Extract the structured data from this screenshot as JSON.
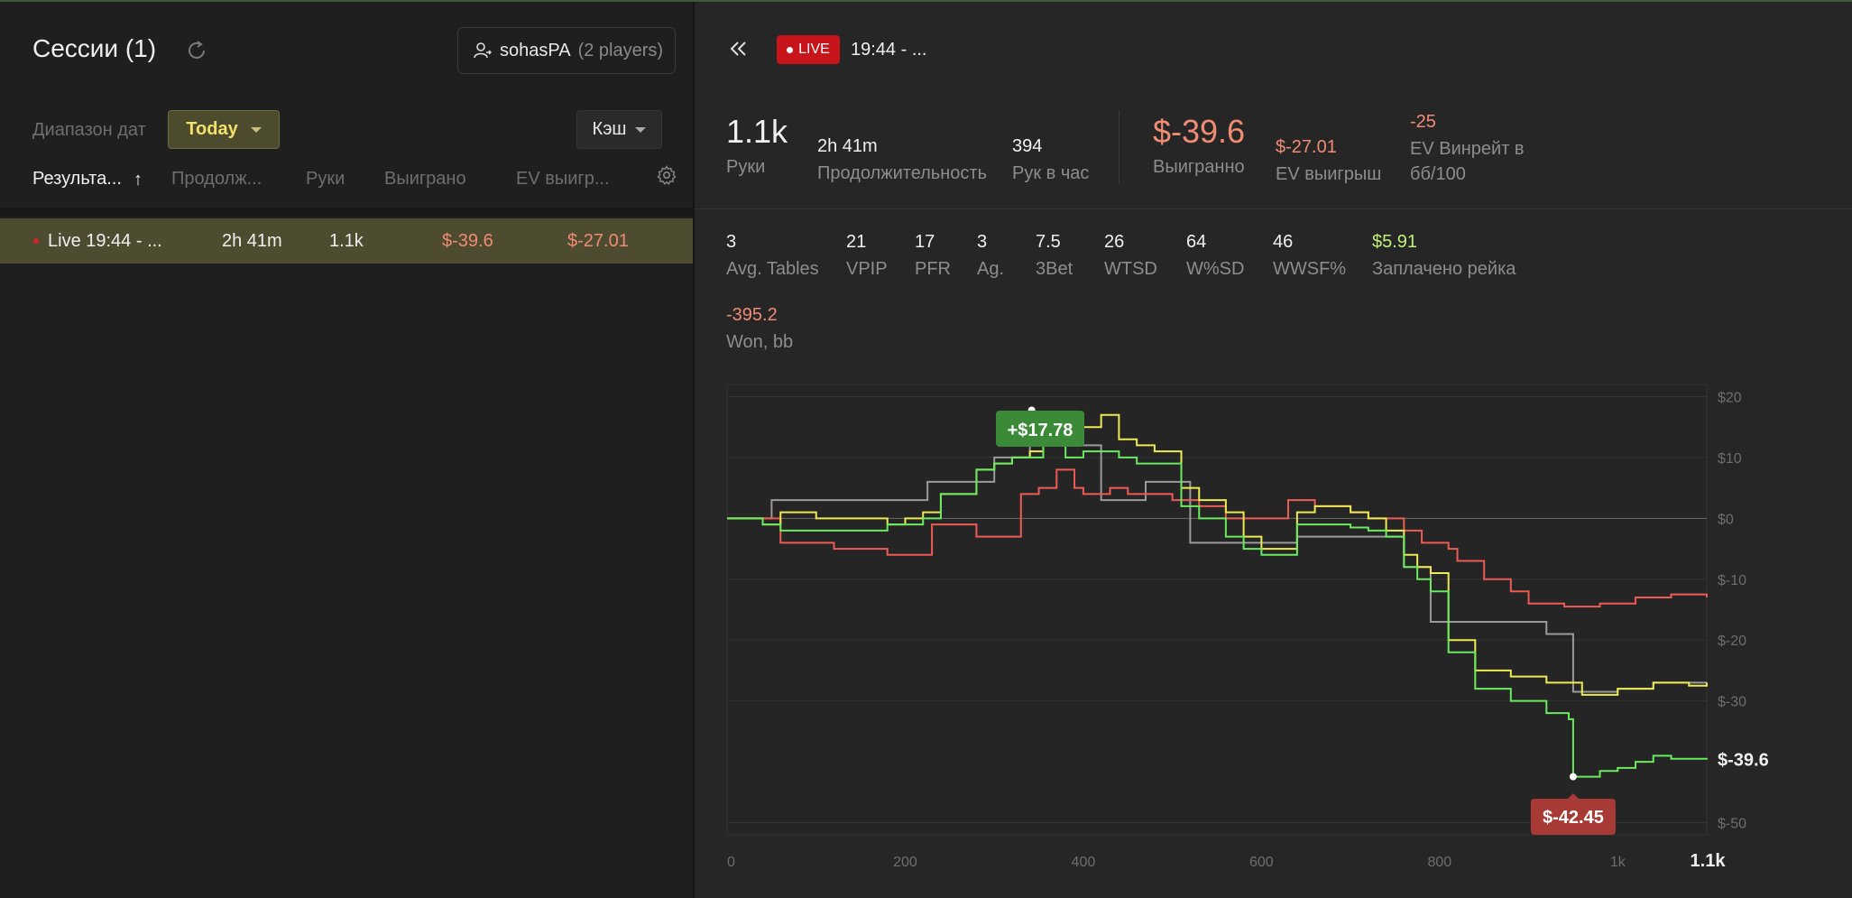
{
  "sidebar": {
    "title": "Сессии (1)",
    "player_name": "sohasPA",
    "player_count": "(2 players)",
    "range_label": "Диапазон дат",
    "range_value": "Today",
    "game_type": "Кэш",
    "columns": [
      "Результа...",
      "Продолж...",
      "Руки",
      "Выиграно",
      "EV выигр..."
    ],
    "sessions": [
      {
        "name": "Live 19:44 - ...",
        "duration": "2h 41m",
        "hands": "1.1k",
        "won": "$-39.6",
        "ev_won": "$-27.01"
      }
    ]
  },
  "header": {
    "live_badge": "LIVE",
    "title": "19:44 - ..."
  },
  "stats_top": {
    "hands": {
      "value": "1.1k",
      "label": "Руки"
    },
    "duration": {
      "value": "2h 41m",
      "label": "Продолжительность"
    },
    "hands_per_hour": {
      "value": "394",
      "label": "Рук в час"
    },
    "won": {
      "value": "$-39.6",
      "label": "Выигранно"
    },
    "ev_won": {
      "value": "$-27.01",
      "label": "EV выигрыш"
    },
    "ev_winrate": {
      "value": "-25",
      "label_line1": "EV Винрейт в",
      "label_line2": "бб/100"
    }
  },
  "stats_row": [
    {
      "value": "3",
      "label": "Avg. Tables"
    },
    {
      "value": "21",
      "label": "VPIP"
    },
    {
      "value": "17",
      "label": "PFR"
    },
    {
      "value": "3",
      "label": "Ag."
    },
    {
      "value": "7.5",
      "label": "3Bet"
    },
    {
      "value": "26",
      "label": "WTSD"
    },
    {
      "value": "64",
      "label": "W%SD"
    },
    {
      "value": "46",
      "label": "WWSF%"
    },
    {
      "value": "$5.91",
      "label": "Заплачено рейка"
    }
  ],
  "won_bb": {
    "value": "-395.2",
    "label": "Won, bb"
  },
  "colors": {
    "green": "#6bea5f",
    "yellow": "#ecea54",
    "red": "#ed5b55",
    "gray": "#9a9a9a",
    "accent_bg": "#4e4c30",
    "negative": "#f08c73"
  },
  "chart_data": {
    "type": "line",
    "xlim": [
      0,
      1100
    ],
    "ylim": [
      -52,
      22
    ],
    "x_ticks": [
      {
        "v": 0,
        "label": "0"
      },
      {
        "v": 200,
        "label": "200"
      },
      {
        "v": 400,
        "label": "400"
      },
      {
        "v": 600,
        "label": "600"
      },
      {
        "v": 800,
        "label": "800"
      },
      {
        "v": 1000,
        "label": "1k"
      }
    ],
    "x_end_label": "1.1k",
    "y_ticks": [
      {
        "v": 20,
        "label": "$20"
      },
      {
        "v": 10,
        "label": "$10"
      },
      {
        "v": 0,
        "label": "$0"
      },
      {
        "v": -10,
        "label": "$-10"
      },
      {
        "v": -20,
        "label": "$-20"
      },
      {
        "v": -30,
        "label": "$-30"
      },
      {
        "v": -50,
        "label": "$-50"
      }
    ],
    "end_label": "$-39.6",
    "max_label": "+$17.78",
    "min_label": "$-42.45",
    "max_point": {
      "x": 342,
      "y": 17.78
    },
    "min_point": {
      "x": 950,
      "y": -42.45
    },
    "series": [
      {
        "color": "#9a9a9a",
        "x": [
          0,
          50,
          140,
          225,
          245,
          300,
          340,
          380,
          420,
          430,
          470,
          500,
          520,
          600,
          640,
          700,
          760,
          770,
          790,
          920,
          950,
          1000,
          1040,
          1100
        ],
        "y": [
          0,
          3,
          3,
          6,
          6,
          10,
          12,
          12,
          3,
          3,
          6,
          6,
          -4,
          -4,
          -3,
          -3,
          -8,
          -8,
          -17,
          -19,
          -28.5,
          -28,
          -27,
          -27
        ]
      },
      {
        "color": "#ed5b55",
        "x": [
          0,
          40,
          60,
          120,
          180,
          230,
          280,
          320,
          330,
          350,
          370,
          390,
          400,
          430,
          450,
          500,
          530,
          560,
          600,
          630,
          660,
          700,
          720,
          760,
          780,
          800,
          810,
          820,
          850,
          880,
          900,
          940,
          980,
          1020,
          1060,
          1100
        ],
        "y": [
          0,
          0,
          -4,
          -5,
          -6,
          -1,
          -3,
          -3,
          4,
          5,
          8,
          5,
          4,
          5,
          4,
          3,
          2,
          0,
          0,
          3,
          2,
          1,
          0,
          -2,
          -4,
          -4,
          -5,
          -7,
          -10,
          -12,
          -14,
          -14.5,
          -14,
          -13,
          -12.5,
          -13
        ]
      },
      {
        "color": "#ecea54",
        "x": [
          0,
          40,
          60,
          100,
          140,
          180,
          200,
          220,
          240,
          280,
          300,
          320,
          340,
          355,
          360,
          380,
          400,
          420,
          440,
          460,
          480,
          495,
          510,
          530,
          560,
          580,
          600,
          640,
          660,
          700,
          720,
          740,
          760,
          775,
          790,
          810,
          840,
          880,
          920,
          960,
          1000,
          1040,
          1080,
          1100
        ],
        "y": [
          0,
          -1,
          1,
          0,
          0,
          -1,
          0,
          1,
          4,
          8,
          9,
          10,
          11,
          17.5,
          15,
          13,
          15,
          17,
          13,
          12,
          11,
          11,
          5,
          3,
          1,
          -3,
          -5,
          1,
          2,
          1,
          0,
          -2,
          -6,
          -8,
          -9,
          -20,
          -25,
          -26,
          -27,
          -29,
          -28,
          -27,
          -27.5,
          -27
        ]
      },
      {
        "color": "#6bea5f",
        "x": [
          0,
          40,
          60,
          100,
          140,
          180,
          200,
          220,
          240,
          280,
          300,
          320,
          340,
          355,
          360,
          380,
          400,
          420,
          440,
          460,
          480,
          495,
          510,
          530,
          560,
          580,
          600,
          640,
          660,
          700,
          720,
          740,
          760,
          775,
          790,
          810,
          840,
          880,
          920,
          945,
          950,
          980,
          1000,
          1020,
          1040,
          1060,
          1080,
          1100
        ],
        "y": [
          0,
          -1,
          -2,
          -2,
          -2,
          -1,
          -1,
          0,
          4,
          8,
          9,
          10,
          10,
          16,
          15,
          10,
          11,
          11,
          10,
          9,
          9,
          9,
          2,
          0,
          -3,
          -5,
          -6,
          -1,
          -1,
          -1.5,
          -2,
          -3,
          -8,
          -10,
          -12,
          -22,
          -28,
          -30,
          -32,
          -33,
          -42.45,
          -41.5,
          -41,
          -40,
          -39,
          -39.5,
          -39.5,
          -39.6
        ]
      }
    ]
  }
}
